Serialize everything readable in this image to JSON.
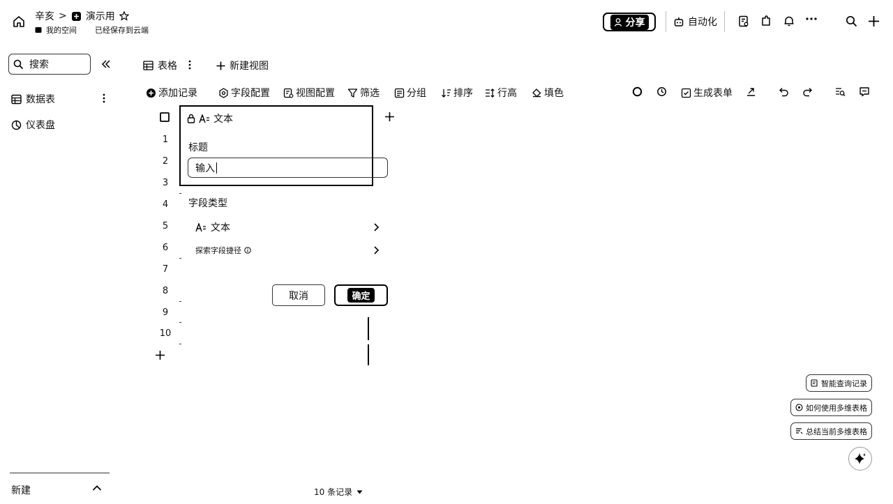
{
  "topbar": {
    "owner": "辛亥",
    "doc_title": "演示用",
    "space": "我的空间",
    "save_status": "已经保存到云端",
    "share_label": "分享",
    "automation_label": "自动化"
  },
  "sidebar": {
    "search_label": "搜索",
    "items": [
      {
        "label": "数据表"
      },
      {
        "label": "仪表盘"
      }
    ],
    "new_label": "新建"
  },
  "views": {
    "grid_label": "表格",
    "new_view_label": "新建视图"
  },
  "toolbar": {
    "add_record": "添加记录",
    "field_config": "字段配置",
    "view_config": "视图配置",
    "filter": "筛选",
    "group": "分组",
    "sort": "排序",
    "row_height": "行高",
    "fill_color": "填色",
    "generate_form": "生成表单"
  },
  "grid": {
    "rows": [
      "1",
      "2",
      "3",
      "4",
      "5",
      "6",
      "7",
      "8",
      "9",
      "10"
    ],
    "record_count": "10 条记录"
  },
  "field_popup": {
    "header_type": "文本",
    "title_label": "标题",
    "title_value": "输入",
    "type_section_label": "字段类型",
    "type_value": "文本",
    "explore_label": "探索字段捷径",
    "cancel_label": "取消",
    "confirm_label": "确定"
  },
  "assistant": {
    "chips": [
      "智能查询记录",
      "如何使用多维表格",
      "总结当前多维表格"
    ]
  }
}
